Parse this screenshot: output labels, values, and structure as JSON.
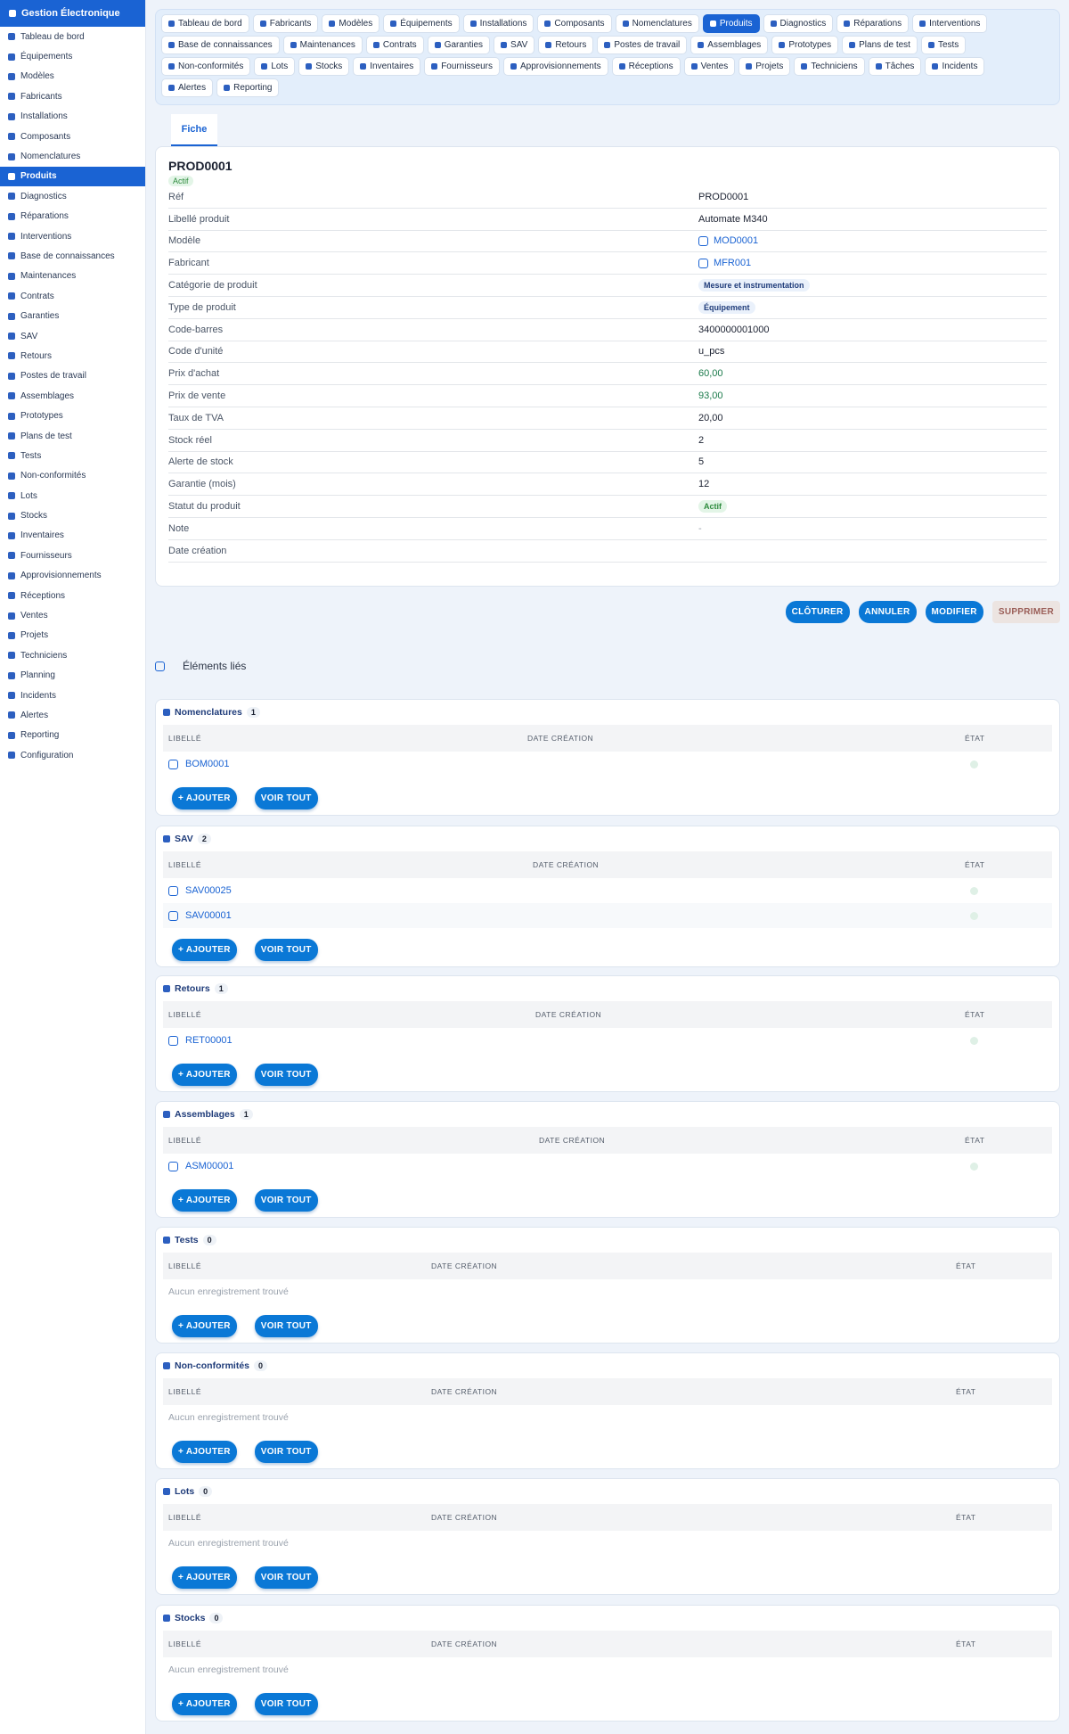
{
  "sidebar": {
    "brand": "Gestion Électronique",
    "items": [
      {
        "label": "Tableau de bord",
        "active": false
      },
      {
        "label": "Équipements",
        "active": false
      },
      {
        "label": "Modèles",
        "active": false
      },
      {
        "label": "Fabricants",
        "active": false
      },
      {
        "label": "Installations",
        "active": false
      },
      {
        "label": "Composants",
        "active": false
      },
      {
        "label": "Nomenclatures",
        "active": false
      },
      {
        "label": "Produits",
        "active": true
      },
      {
        "label": "Diagnostics",
        "active": false
      },
      {
        "label": "Réparations",
        "active": false
      },
      {
        "label": "Interventions",
        "active": false
      },
      {
        "label": "Base de connaissances",
        "active": false
      },
      {
        "label": "Maintenances",
        "active": false
      },
      {
        "label": "Contrats",
        "active": false
      },
      {
        "label": "Garanties",
        "active": false
      },
      {
        "label": "SAV",
        "active": false
      },
      {
        "label": "Retours",
        "active": false
      },
      {
        "label": "Postes de travail",
        "active": false
      },
      {
        "label": "Assemblages",
        "active": false
      },
      {
        "label": "Prototypes",
        "active": false
      },
      {
        "label": "Plans de test",
        "active": false
      },
      {
        "label": "Tests",
        "active": false
      },
      {
        "label": "Non-conformités",
        "active": false
      },
      {
        "label": "Lots",
        "active": false
      },
      {
        "label": "Stocks",
        "active": false
      },
      {
        "label": "Inventaires",
        "active": false
      },
      {
        "label": "Fournisseurs",
        "active": false
      },
      {
        "label": "Approvisionnements",
        "active": false
      },
      {
        "label": "Réceptions",
        "active": false
      },
      {
        "label": "Ventes",
        "active": false
      },
      {
        "label": "Projets",
        "active": false
      },
      {
        "label": "Techniciens",
        "active": false
      },
      {
        "label": "Planning",
        "active": false
      },
      {
        "label": "Incidents",
        "active": false
      },
      {
        "label": "Alertes",
        "active": false
      },
      {
        "label": "Reporting",
        "active": false
      },
      {
        "label": "Configuration",
        "active": false
      }
    ]
  },
  "topnav": {
    "rows": [
      [
        {
          "label": "Tableau de bord"
        },
        {
          "label": "Fabricants"
        },
        {
          "label": "Modèles"
        },
        {
          "label": "Équipements"
        },
        {
          "label": "Installations"
        },
        {
          "label": "Composants"
        },
        {
          "label": "Nomenclatures"
        },
        {
          "label": "Produits",
          "active": true
        },
        {
          "label": "Diagnostics"
        },
        {
          "label": "Réparations"
        },
        {
          "label": "Interventions"
        }
      ],
      [
        {
          "label": "Base de connaissances"
        },
        {
          "label": "Maintenances"
        },
        {
          "label": "Contrats"
        },
        {
          "label": "Garanties"
        },
        {
          "label": "SAV"
        },
        {
          "label": "Retours"
        },
        {
          "label": "Postes de travail"
        },
        {
          "label": "Assemblages"
        },
        {
          "label": "Prototypes"
        },
        {
          "label": "Plans de test"
        },
        {
          "label": "Tests"
        }
      ],
      [
        {
          "label": "Non-conformités"
        },
        {
          "label": "Lots"
        },
        {
          "label": "Stocks"
        },
        {
          "label": "Inventaires"
        },
        {
          "label": "Fournisseurs"
        },
        {
          "label": "Approvisionnements"
        },
        {
          "label": "Réceptions"
        },
        {
          "label": "Ventes"
        },
        {
          "label": "Projets"
        },
        {
          "label": "Techniciens"
        },
        {
          "label": "Tâches"
        },
        {
          "label": "Incidents"
        }
      ],
      [
        {
          "label": "Alertes"
        },
        {
          "label": "Reporting"
        }
      ]
    ]
  },
  "tab": {
    "label": "Fiche"
  },
  "record": {
    "ref": "PROD0001",
    "status_badge": "Actif",
    "fields": [
      {
        "label": "Réf",
        "value": "PROD0001",
        "type": "text"
      },
      {
        "label": "Libellé produit",
        "value": "Automate M340",
        "type": "text"
      },
      {
        "label": "Modèle",
        "value": "MOD0001",
        "type": "link"
      },
      {
        "label": "Fabricant",
        "value": "MFR001",
        "type": "link"
      },
      {
        "label": "Catégorie de produit",
        "value": "Mesure et instrumentation",
        "type": "tag"
      },
      {
        "label": "Type de produit",
        "value": "Équipement",
        "type": "tag"
      },
      {
        "label": "Code-barres",
        "value": "3400000001000",
        "type": "text"
      },
      {
        "label": "Code d'unité",
        "value": "u_pcs",
        "type": "text"
      },
      {
        "label": "Prix d'achat",
        "value": "60,00",
        "type": "money"
      },
      {
        "label": "Prix de vente",
        "value": "93,00",
        "type": "money"
      },
      {
        "label": "Taux de TVA",
        "value": "20,00",
        "type": "text"
      },
      {
        "label": "Stock réel",
        "value": "2",
        "type": "text"
      },
      {
        "label": "Alerte de stock",
        "value": "5",
        "type": "text"
      },
      {
        "label": "Garantie (mois)",
        "value": "12",
        "type": "text"
      },
      {
        "label": "Statut du produit",
        "value": "Actif",
        "type": "tag-green"
      },
      {
        "label": "Note",
        "value": "-",
        "type": "muted"
      },
      {
        "label": "Date création",
        "value": "",
        "type": "text"
      }
    ]
  },
  "actions": {
    "cloturer": "CLÔTURER",
    "annuler": "ANNULER",
    "modifier": "MODIFIER",
    "supprimer": "SUPPRIMER"
  },
  "linked": {
    "title": "Éléments liés",
    "col_libelle": "LIBELLÉ",
    "col_date": "DATE CRÉATION",
    "col_etat": "ÉTAT",
    "empty_text": "Aucun enregistrement trouvé",
    "add_label": "+ AJOUTER",
    "view_label": "VOIR TOUT",
    "sections": [
      {
        "name": "Nomenclatures",
        "count": "1",
        "rows": [
          "BOM0001"
        ]
      },
      {
        "name": "SAV",
        "count": "2",
        "rows": [
          "SAV00025",
          "SAV00001"
        ]
      },
      {
        "name": "Retours",
        "count": "1",
        "rows": [
          "RET00001"
        ]
      },
      {
        "name": "Assemblages",
        "count": "1",
        "rows": [
          "ASM00001"
        ]
      },
      {
        "name": "Tests",
        "count": "0",
        "rows": []
      },
      {
        "name": "Non-conformités",
        "count": "0",
        "rows": []
      },
      {
        "name": "Lots",
        "count": "0",
        "rows": []
      },
      {
        "name": "Stocks",
        "count": "0",
        "rows": []
      }
    ]
  },
  "colors": {
    "accent": "#1a63d3",
    "button": "#0a78d6",
    "sidebar_bg": "#ffffff",
    "page_bg": "#eef3fa"
  }
}
